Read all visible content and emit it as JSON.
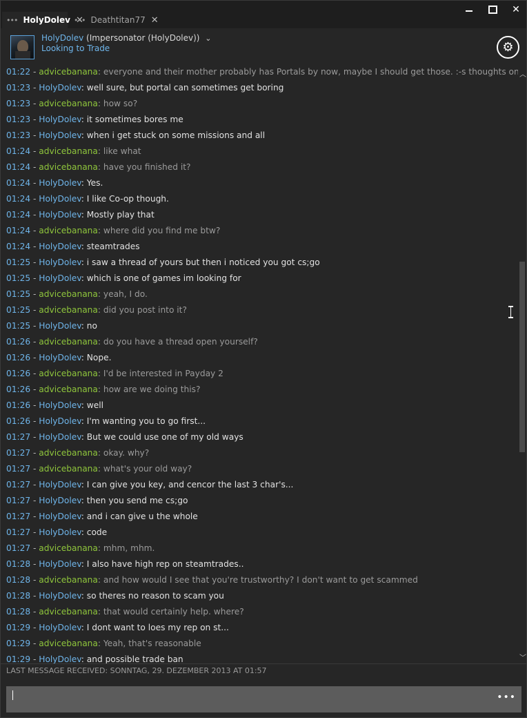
{
  "tabs": [
    {
      "label": "HolyDolev",
      "active": true
    },
    {
      "label": "Deathtitan77",
      "active": false
    }
  ],
  "header": {
    "name": "HolyDolev",
    "nickname": "(Impersonator (HolyDolev))",
    "status": "Looking to Trade"
  },
  "colors": {
    "self_name": "#6fb5ea",
    "partner_name": "#8fc63c",
    "timestamp": "#6fb5ea",
    "partner_text": "#9b9b9b",
    "self_text": "#e2e2e2"
  },
  "icons": {
    "tab_menu": "ellipsis-icon",
    "tab_close": "close-icon",
    "settings": "gear-icon",
    "dropdown": "chevron-down-icon",
    "more": "more-icon"
  },
  "messages": [
    {
      "time": "01:22",
      "sender": "advicebanana",
      "text": "everyone and their mother probably has Portals by now, maybe I should get those. :-s thoughts on them?"
    },
    {
      "time": "01:23",
      "sender": "HolyDolev",
      "text": "well sure, but portal can sometimes get boring"
    },
    {
      "time": "01:23",
      "sender": "advicebanana",
      "text": "how so?"
    },
    {
      "time": "01:23",
      "sender": "HolyDolev",
      "text": "it sometimes bores me"
    },
    {
      "time": "01:23",
      "sender": "HolyDolev",
      "text": "when i get stuck on some missions and all"
    },
    {
      "time": "01:24",
      "sender": "advicebanana",
      "text": "like what"
    },
    {
      "time": "01:24",
      "sender": "advicebanana",
      "text": "have you finished it?"
    },
    {
      "time": "01:24",
      "sender": "HolyDolev",
      "text": "Yes."
    },
    {
      "time": "01:24",
      "sender": "HolyDolev",
      "text": "I like Co-op though."
    },
    {
      "time": "01:24",
      "sender": "HolyDolev",
      "text": "Mostly play that"
    },
    {
      "time": "01:24",
      "sender": "advicebanana",
      "text": "where did you find me btw?"
    },
    {
      "time": "01:24",
      "sender": "HolyDolev",
      "text": "steamtrades"
    },
    {
      "time": "01:25",
      "sender": "HolyDolev",
      "text": "i saw a thread of yours but then i noticed you got cs;go"
    },
    {
      "time": "01:25",
      "sender": "HolyDolev",
      "text": "which is one of games im looking for"
    },
    {
      "time": "01:25",
      "sender": "advicebanana",
      "text": "yeah, I do."
    },
    {
      "time": "01:25",
      "sender": "advicebanana",
      "text": "did you post into it?"
    },
    {
      "time": "01:25",
      "sender": "HolyDolev",
      "text": "no"
    },
    {
      "time": "01:26",
      "sender": "advicebanana",
      "text": "do you have a thread open yourself?"
    },
    {
      "time": "01:26",
      "sender": "HolyDolev",
      "text": "Nope."
    },
    {
      "time": "01:26",
      "sender": "advicebanana",
      "text": "I'd be interested in Payday 2"
    },
    {
      "time": "01:26",
      "sender": "advicebanana",
      "text": "how are we doing this?"
    },
    {
      "time": "01:26",
      "sender": "HolyDolev",
      "text": "well"
    },
    {
      "time": "01:26",
      "sender": "HolyDolev",
      "text": "I'm wanting you to go first..."
    },
    {
      "time": "01:27",
      "sender": "HolyDolev",
      "text": "But we could use one of my old ways"
    },
    {
      "time": "01:27",
      "sender": "advicebanana",
      "text": "okay. why?"
    },
    {
      "time": "01:27",
      "sender": "advicebanana",
      "text": "what's your old way?"
    },
    {
      "time": "01:27",
      "sender": "HolyDolev",
      "text": "I can give you key, and cencor the last 3 char's..."
    },
    {
      "time": "01:27",
      "sender": "HolyDolev",
      "text": "then you send me cs;go"
    },
    {
      "time": "01:27",
      "sender": "HolyDolev",
      "text": "and i can give u the whole"
    },
    {
      "time": "01:27",
      "sender": "HolyDolev",
      "text": "code"
    },
    {
      "time": "01:27",
      "sender": "advicebanana",
      "text": "mhm, mhm."
    },
    {
      "time": "01:28",
      "sender": "HolyDolev",
      "text": "I also have high rep on steamtrades.."
    },
    {
      "time": "01:28",
      "sender": "advicebanana",
      "text": "and how would I see that you're trustworthy? I don't want to get scammed"
    },
    {
      "time": "01:28",
      "sender": "HolyDolev",
      "text": "so theres no reason to scam you"
    },
    {
      "time": "01:28",
      "sender": "advicebanana",
      "text": "that would certainly help. where?"
    },
    {
      "time": "01:29",
      "sender": "HolyDolev",
      "text": "I dont want to loes my rep on st..."
    },
    {
      "time": "01:29",
      "sender": "advicebanana",
      "text": "Yeah, that's reasonable"
    },
    {
      "time": "01:29",
      "sender": "HolyDolev",
      "text": "and possible trade ban"
    }
  ],
  "footer": {
    "last_message": "LAST MESSAGE RECEIVED: SONNTAG, 29. DEZEMBER 2013 AT 01:57"
  },
  "input": {
    "value": "",
    "more_label": "•••"
  }
}
